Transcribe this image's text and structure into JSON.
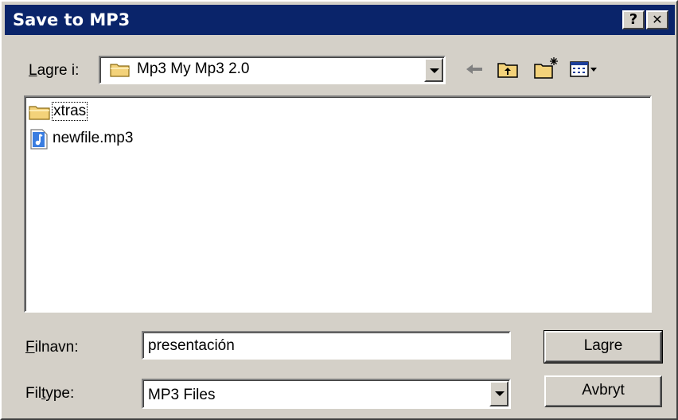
{
  "window": {
    "title": "Save to MP3",
    "help_glyph": "?",
    "close_glyph": "✕"
  },
  "location": {
    "label": "Lagre i:",
    "value": "Mp3 My Mp3 2.0"
  },
  "toolbar": {
    "back_icon": "back-arrow-icon",
    "up_icon": "up-folder-icon",
    "new_folder_icon": "new-folder-icon",
    "view_menu_icon": "view-menu-icon"
  },
  "files": [
    {
      "name": "xtras",
      "type": "folder"
    },
    {
      "name": "newfile.mp3",
      "type": "mp3"
    }
  ],
  "filename": {
    "label": "Filnavn:",
    "value": "presentación"
  },
  "filetype": {
    "label": "Filtype:",
    "value": "MP3 Files"
  },
  "buttons": {
    "save": "Lagre",
    "cancel": "Avbryt"
  },
  "colors": {
    "titlebar": "#0a246a",
    "face": "#d4d0c8"
  }
}
